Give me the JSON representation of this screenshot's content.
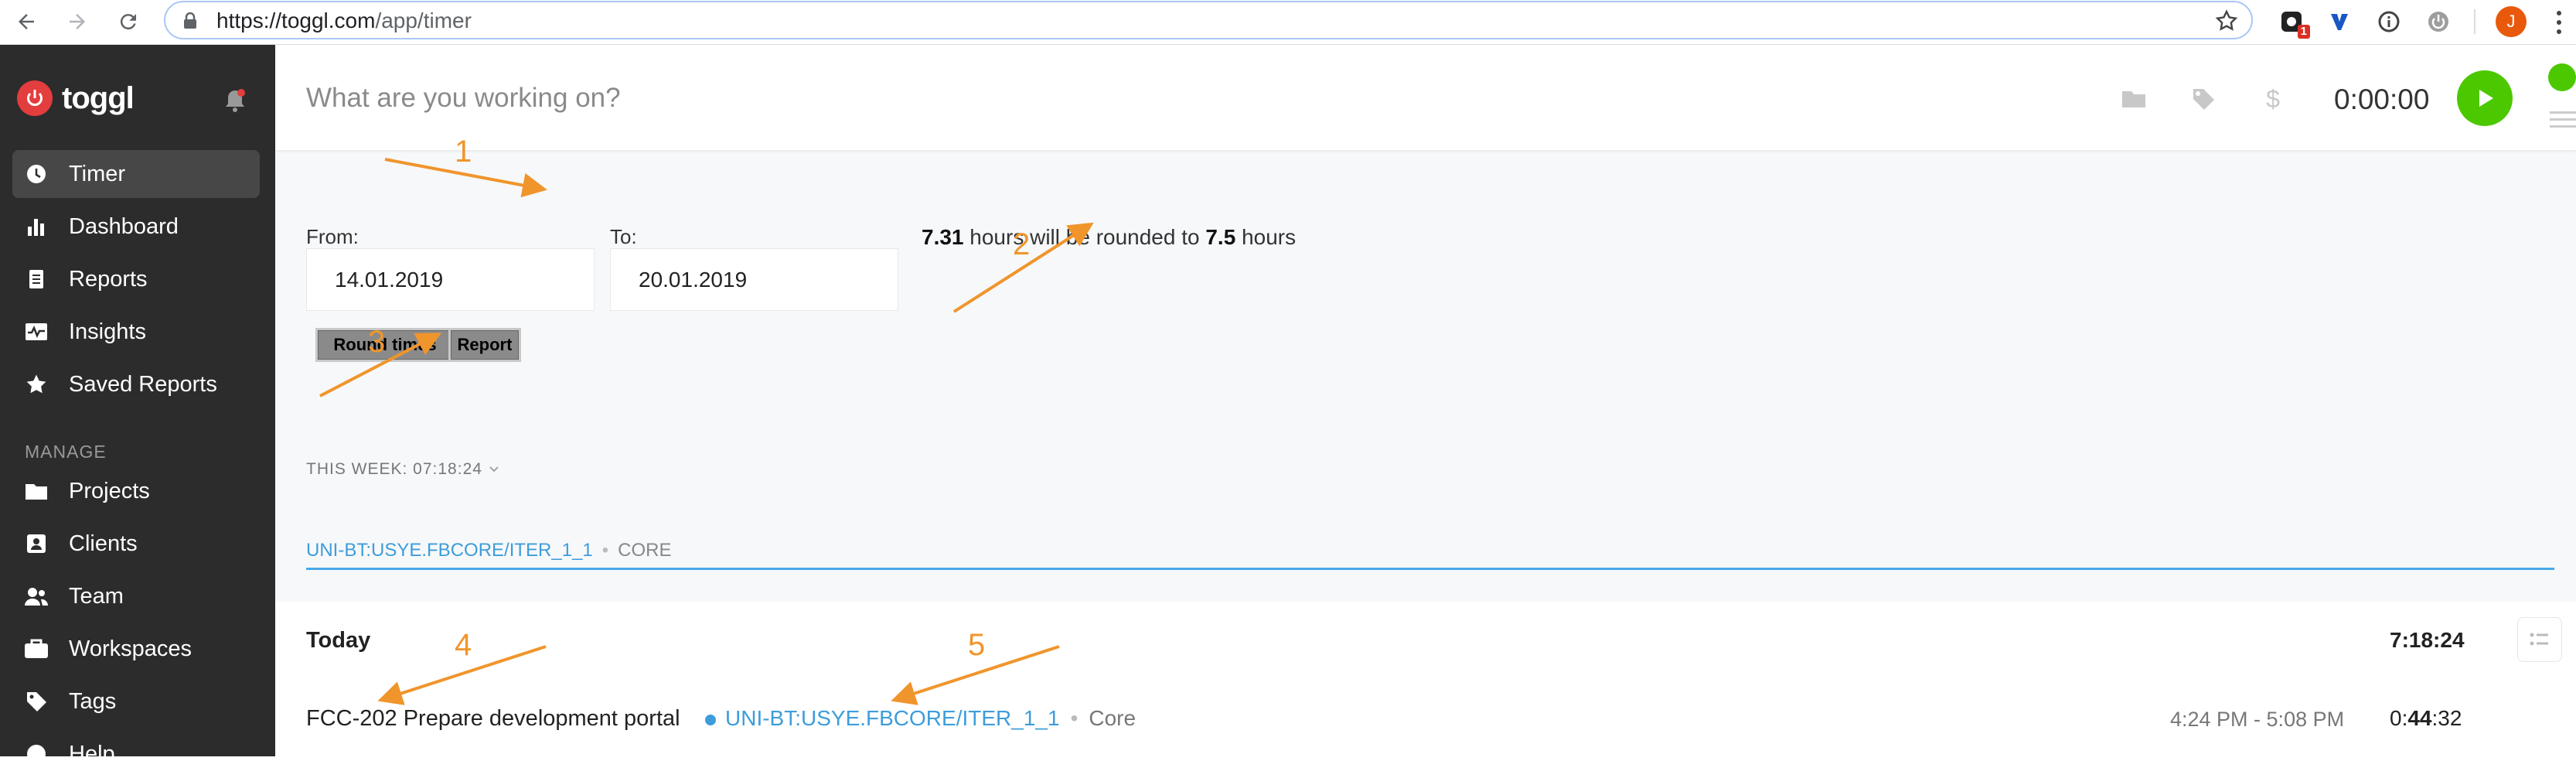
{
  "browser": {
    "url_host": "https://toggl.com",
    "url_path": "/app/timer",
    "extension_badge": "1",
    "avatar_letter": "J"
  },
  "sidebar": {
    "brand": "toggl",
    "items": [
      {
        "label": "Timer",
        "icon": "clock-icon",
        "active": true
      },
      {
        "label": "Dashboard",
        "icon": "bar-chart-icon"
      },
      {
        "label": "Reports",
        "icon": "document-icon"
      },
      {
        "label": "Insights",
        "icon": "pulse-icon"
      },
      {
        "label": "Saved Reports",
        "icon": "star-icon"
      }
    ],
    "manage_heading": "MANAGE",
    "manage_items": [
      {
        "label": "Projects",
        "icon": "folder-icon"
      },
      {
        "label": "Clients",
        "icon": "person-badge-icon"
      },
      {
        "label": "Team",
        "icon": "team-icon"
      },
      {
        "label": "Workspaces",
        "icon": "briefcase-icon"
      },
      {
        "label": "Tags",
        "icon": "tag-icon"
      },
      {
        "label": "Help",
        "icon": "help-icon"
      }
    ]
  },
  "timer": {
    "placeholder": "What are you working on?",
    "duration": "0:00:00"
  },
  "rounding": {
    "from_label": "From:",
    "from_value": "14.01.2019",
    "to_label": "To:",
    "to_value": "20.01.2019",
    "round_button": "Round times",
    "report_button": "Report",
    "hours": "7.31",
    "msg_mid": "hours will be rounded to",
    "rounded": "7.5",
    "msg_end": "hours"
  },
  "week": {
    "label": "THIS WEEK: 07:18:24"
  },
  "project_filter": {
    "project": "UNI-BT:USYE.FBCORE/ITER_1_1",
    "client": "CORE"
  },
  "day": {
    "title": "Today",
    "total": "7:18:24",
    "entries": [
      {
        "description": "FCC-202 Prepare development portal",
        "project": "UNI-BT:USYE.FBCORE/ITER_1_1",
        "client": "Core",
        "range": "4:24 PM - 5:08 PM",
        "duration_prefix": "0:",
        "duration_bold": "44",
        "duration_suffix": ":32"
      }
    ]
  },
  "annotations": [
    "1",
    "2",
    "3",
    "4",
    "5"
  ],
  "colors": {
    "sidebar_bg": "#2c2c2c",
    "play_green": "#4bc800",
    "project_blue": "#3d9ddb",
    "annotation_orange": "#f0952c",
    "logo_red": "#e33d3d"
  }
}
